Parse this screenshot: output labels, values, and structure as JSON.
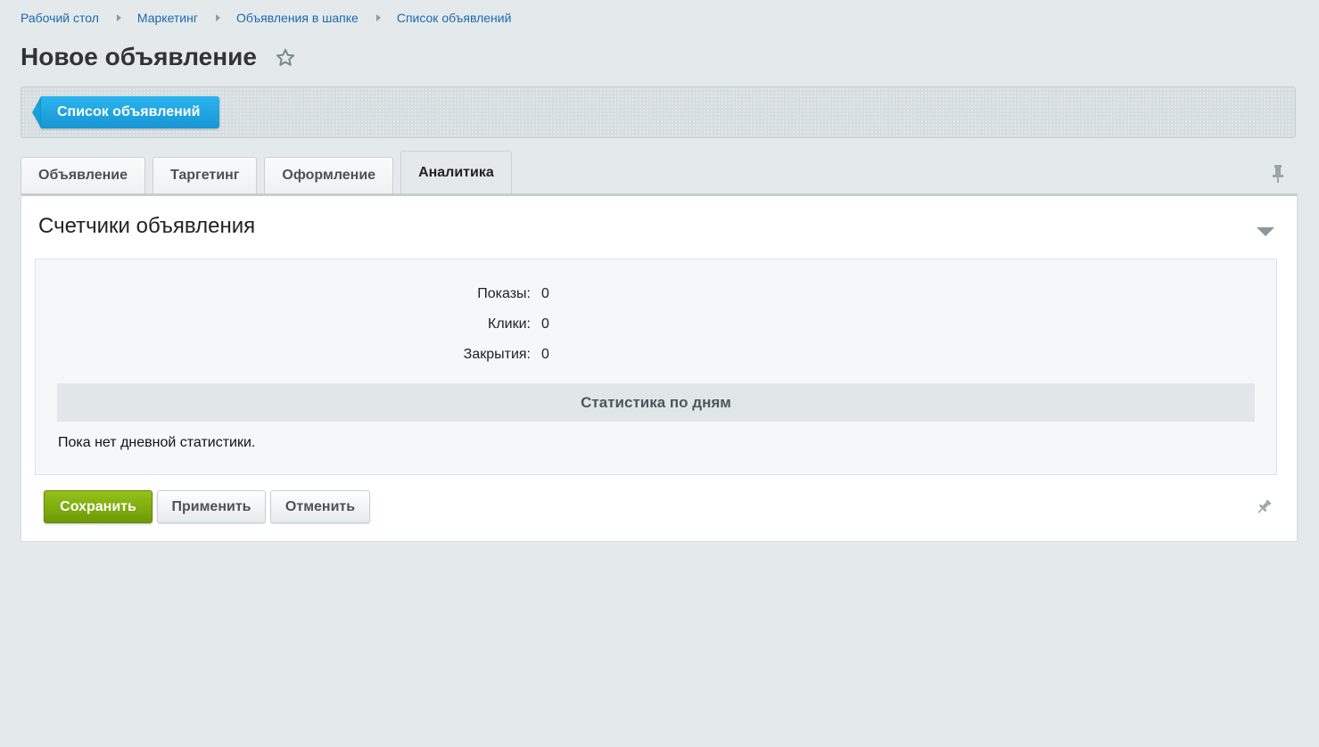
{
  "breadcrumbs": [
    {
      "label": "Рабочий стол"
    },
    {
      "label": "Маркетинг"
    },
    {
      "label": "Объявления в шапке"
    },
    {
      "label": "Список объявлений"
    }
  ],
  "page": {
    "title": "Новое объявление",
    "favorite_icon": "star-outline-icon"
  },
  "toolbar": {
    "back_label": "Список объявлений",
    "back_color": "#1b9fd9"
  },
  "tabs": [
    {
      "label": "Объявление",
      "active": false
    },
    {
      "label": "Таргетинг",
      "active": false
    },
    {
      "label": "Оформление",
      "active": false
    },
    {
      "label": "Аналитика",
      "active": true
    }
  ],
  "section": {
    "title": "Счетчики объявления",
    "stats": [
      {
        "label": "Показы:",
        "value": "0"
      },
      {
        "label": "Клики:",
        "value": "0"
      },
      {
        "label": "Закрытия:",
        "value": "0"
      }
    ],
    "daily_header": "Статистика по дням",
    "daily_empty": "Пока нет дневной статистики."
  },
  "buttons": {
    "save": "Сохранить",
    "apply": "Применить",
    "cancel": "Отменить",
    "save_color": "#7aa90d"
  },
  "icons": {
    "tabs_pin": "pin-icon",
    "footer_pin": "pin-icon",
    "collapse": "triangle-down-icon"
  }
}
